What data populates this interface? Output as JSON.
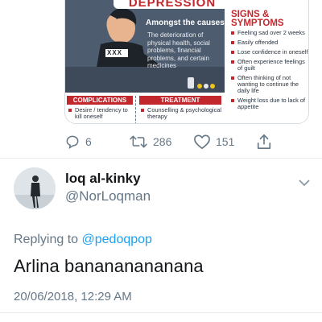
{
  "infographic": {
    "title": "DEPRESSION",
    "causes_heading": "Amongst the causes:",
    "causes_body": "The deterioration of physical health, social problems, financial problems, and certain medicines",
    "shirt_text": "XXX",
    "signs_heading_line1": "SIGNS &",
    "signs_heading_line2": "SYMPTOMS",
    "signs": [
      "Feeling sad over 2 weeks",
      "Easily offended",
      "Lose confidence in oneself",
      "Often experience feelings of guilt",
      "Often thinking of not wanting to continue the daily life",
      "Weight loss due to lack of appetite"
    ],
    "complications_heading": "COMPLICATIONS",
    "complications": [
      "Desire / tendency to kill oneself"
    ],
    "treatment_heading": "TREATMENT",
    "treatment": [
      "Counselling & psychological therapy"
    ],
    "colors": {
      "accent_red": "#c3272e",
      "panel_slate": "#4d5c6f"
    }
  },
  "actions": {
    "reply_count": "6",
    "retweet_count": "286",
    "like_count": "151",
    "icons": [
      "reply-icon",
      "retweet-icon",
      "like-icon",
      "share-icon"
    ]
  },
  "reply": {
    "display_name": "loq al-kinky",
    "handle": "@NorLoqman",
    "replying_prefix": "Replying to",
    "replying_to": "@pedoqpop",
    "text": "Arlina banananananana",
    "timestamp": "20/06/2018, 12:29 AM"
  },
  "colors": {
    "link_blue": "#1da1f2",
    "secondary_text": "#657786",
    "divider": "#e6ecf0"
  }
}
